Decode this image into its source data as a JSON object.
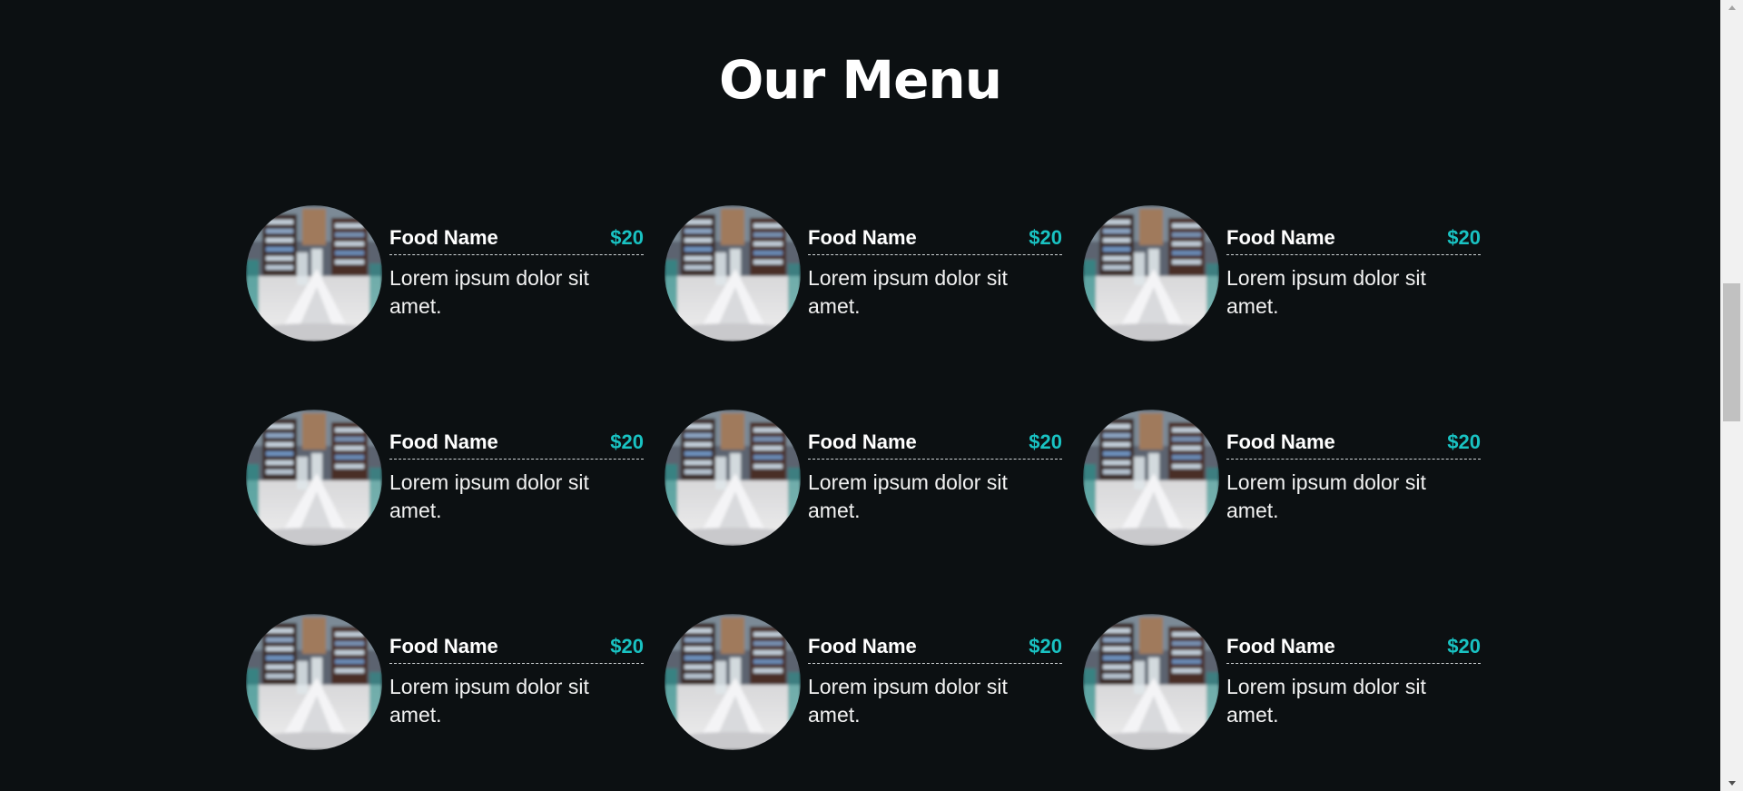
{
  "section": {
    "title": "Our Menu"
  },
  "colors": {
    "background": "#0c1012",
    "accent": "#19c2c2",
    "text": "#ffffff"
  },
  "menu": {
    "items": [
      {
        "name": "Food Name",
        "price": "$20",
        "description": "Lorem ipsum dolor sit amet.",
        "image": "restaurant-table-photo"
      },
      {
        "name": "Food Name",
        "price": "$20",
        "description": "Lorem ipsum dolor sit amet.",
        "image": "restaurant-table-photo"
      },
      {
        "name": "Food Name",
        "price": "$20",
        "description": "Lorem ipsum dolor sit amet.",
        "image": "restaurant-table-photo"
      },
      {
        "name": "Food Name",
        "price": "$20",
        "description": "Lorem ipsum dolor sit amet.",
        "image": "restaurant-table-photo"
      },
      {
        "name": "Food Name",
        "price": "$20",
        "description": "Lorem ipsum dolor sit amet.",
        "image": "restaurant-table-photo"
      },
      {
        "name": "Food Name",
        "price": "$20",
        "description": "Lorem ipsum dolor sit amet.",
        "image": "restaurant-table-photo"
      },
      {
        "name": "Food Name",
        "price": "$20",
        "description": "Lorem ipsum dolor sit amet.",
        "image": "restaurant-table-photo"
      },
      {
        "name": "Food Name",
        "price": "$20",
        "description": "Lorem ipsum dolor sit amet.",
        "image": "restaurant-table-photo"
      },
      {
        "name": "Food Name",
        "price": "$20",
        "description": "Lorem ipsum dolor sit amet.",
        "image": "restaurant-table-photo"
      }
    ]
  },
  "scrollbar": {
    "up_icon": "chevron-up-icon",
    "down_icon": "chevron-down-icon"
  }
}
